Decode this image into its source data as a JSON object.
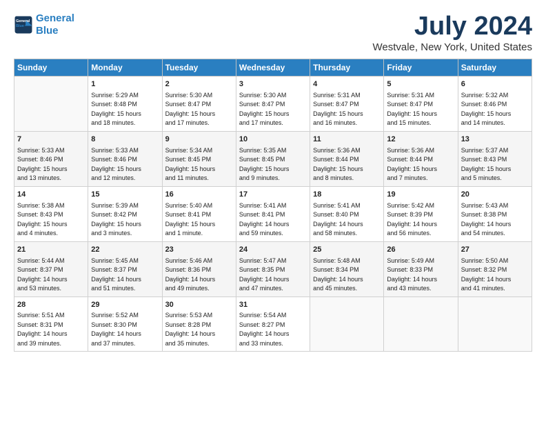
{
  "logo": {
    "line1": "General",
    "line2": "Blue"
  },
  "title": "July 2024",
  "subtitle": "Westvale, New York, United States",
  "days_of_week": [
    "Sunday",
    "Monday",
    "Tuesday",
    "Wednesday",
    "Thursday",
    "Friday",
    "Saturday"
  ],
  "weeks": [
    [
      {
        "day": "",
        "info": ""
      },
      {
        "day": "1",
        "info": "Sunrise: 5:29 AM\nSunset: 8:48 PM\nDaylight: 15 hours\nand 18 minutes."
      },
      {
        "day": "2",
        "info": "Sunrise: 5:30 AM\nSunset: 8:47 PM\nDaylight: 15 hours\nand 17 minutes."
      },
      {
        "day": "3",
        "info": "Sunrise: 5:30 AM\nSunset: 8:47 PM\nDaylight: 15 hours\nand 17 minutes."
      },
      {
        "day": "4",
        "info": "Sunrise: 5:31 AM\nSunset: 8:47 PM\nDaylight: 15 hours\nand 16 minutes."
      },
      {
        "day": "5",
        "info": "Sunrise: 5:31 AM\nSunset: 8:47 PM\nDaylight: 15 hours\nand 15 minutes."
      },
      {
        "day": "6",
        "info": "Sunrise: 5:32 AM\nSunset: 8:46 PM\nDaylight: 15 hours\nand 14 minutes."
      }
    ],
    [
      {
        "day": "7",
        "info": "Sunrise: 5:33 AM\nSunset: 8:46 PM\nDaylight: 15 hours\nand 13 minutes."
      },
      {
        "day": "8",
        "info": "Sunrise: 5:33 AM\nSunset: 8:46 PM\nDaylight: 15 hours\nand 12 minutes."
      },
      {
        "day": "9",
        "info": "Sunrise: 5:34 AM\nSunset: 8:45 PM\nDaylight: 15 hours\nand 11 minutes."
      },
      {
        "day": "10",
        "info": "Sunrise: 5:35 AM\nSunset: 8:45 PM\nDaylight: 15 hours\nand 9 minutes."
      },
      {
        "day": "11",
        "info": "Sunrise: 5:36 AM\nSunset: 8:44 PM\nDaylight: 15 hours\nand 8 minutes."
      },
      {
        "day": "12",
        "info": "Sunrise: 5:36 AM\nSunset: 8:44 PM\nDaylight: 15 hours\nand 7 minutes."
      },
      {
        "day": "13",
        "info": "Sunrise: 5:37 AM\nSunset: 8:43 PM\nDaylight: 15 hours\nand 5 minutes."
      }
    ],
    [
      {
        "day": "14",
        "info": "Sunrise: 5:38 AM\nSunset: 8:43 PM\nDaylight: 15 hours\nand 4 minutes."
      },
      {
        "day": "15",
        "info": "Sunrise: 5:39 AM\nSunset: 8:42 PM\nDaylight: 15 hours\nand 3 minutes."
      },
      {
        "day": "16",
        "info": "Sunrise: 5:40 AM\nSunset: 8:41 PM\nDaylight: 15 hours\nand 1 minute."
      },
      {
        "day": "17",
        "info": "Sunrise: 5:41 AM\nSunset: 8:41 PM\nDaylight: 14 hours\nand 59 minutes."
      },
      {
        "day": "18",
        "info": "Sunrise: 5:41 AM\nSunset: 8:40 PM\nDaylight: 14 hours\nand 58 minutes."
      },
      {
        "day": "19",
        "info": "Sunrise: 5:42 AM\nSunset: 8:39 PM\nDaylight: 14 hours\nand 56 minutes."
      },
      {
        "day": "20",
        "info": "Sunrise: 5:43 AM\nSunset: 8:38 PM\nDaylight: 14 hours\nand 54 minutes."
      }
    ],
    [
      {
        "day": "21",
        "info": "Sunrise: 5:44 AM\nSunset: 8:37 PM\nDaylight: 14 hours\nand 53 minutes."
      },
      {
        "day": "22",
        "info": "Sunrise: 5:45 AM\nSunset: 8:37 PM\nDaylight: 14 hours\nand 51 minutes."
      },
      {
        "day": "23",
        "info": "Sunrise: 5:46 AM\nSunset: 8:36 PM\nDaylight: 14 hours\nand 49 minutes."
      },
      {
        "day": "24",
        "info": "Sunrise: 5:47 AM\nSunset: 8:35 PM\nDaylight: 14 hours\nand 47 minutes."
      },
      {
        "day": "25",
        "info": "Sunrise: 5:48 AM\nSunset: 8:34 PM\nDaylight: 14 hours\nand 45 minutes."
      },
      {
        "day": "26",
        "info": "Sunrise: 5:49 AM\nSunset: 8:33 PM\nDaylight: 14 hours\nand 43 minutes."
      },
      {
        "day": "27",
        "info": "Sunrise: 5:50 AM\nSunset: 8:32 PM\nDaylight: 14 hours\nand 41 minutes."
      }
    ],
    [
      {
        "day": "28",
        "info": "Sunrise: 5:51 AM\nSunset: 8:31 PM\nDaylight: 14 hours\nand 39 minutes."
      },
      {
        "day": "29",
        "info": "Sunrise: 5:52 AM\nSunset: 8:30 PM\nDaylight: 14 hours\nand 37 minutes."
      },
      {
        "day": "30",
        "info": "Sunrise: 5:53 AM\nSunset: 8:28 PM\nDaylight: 14 hours\nand 35 minutes."
      },
      {
        "day": "31",
        "info": "Sunrise: 5:54 AM\nSunset: 8:27 PM\nDaylight: 14 hours\nand 33 minutes."
      },
      {
        "day": "",
        "info": ""
      },
      {
        "day": "",
        "info": ""
      },
      {
        "day": "",
        "info": ""
      }
    ]
  ],
  "colors": {
    "header_bg": "#2a7fc1",
    "header_text": "#ffffff",
    "title_color": "#1a3a5c",
    "logo_blue": "#2a7fc1"
  }
}
